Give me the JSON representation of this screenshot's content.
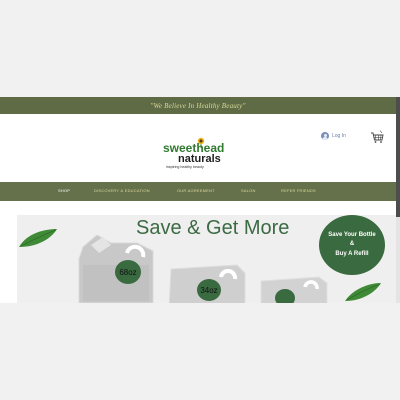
{
  "announcement": {
    "text": "\"We Believe In Healthy Beauty\""
  },
  "header": {
    "login_label": "Log In",
    "logo": {
      "line1": "sweethead",
      "line2": "naturals",
      "tagline": "inspiring healthy beauty"
    }
  },
  "nav": {
    "items": [
      {
        "label": "SHOP",
        "active": true
      },
      {
        "label": "DISCOVERY & EDUCATION",
        "active": false
      },
      {
        "label": "OUR AGREEMENT",
        "active": false
      },
      {
        "label": "SALON",
        "active": false
      },
      {
        "label": "REFER FRIENDS",
        "active": false
      }
    ]
  },
  "hero": {
    "title": "Save & Get More",
    "badge": {
      "line1": "Save Your Bottle",
      "line2": "&",
      "line3": "Buy A Refill"
    },
    "sizes": [
      "68oz",
      "34oz"
    ]
  },
  "colors": {
    "brand_green": "#3a6a3f",
    "nav_olive": "#65714b",
    "nav_text": "#d9d79b",
    "hero_bg": "#efefef"
  },
  "icons": [
    "user-avatar-icon",
    "shopping-cart-icon",
    "sunflower-logo-icon",
    "leaf-icon"
  ]
}
